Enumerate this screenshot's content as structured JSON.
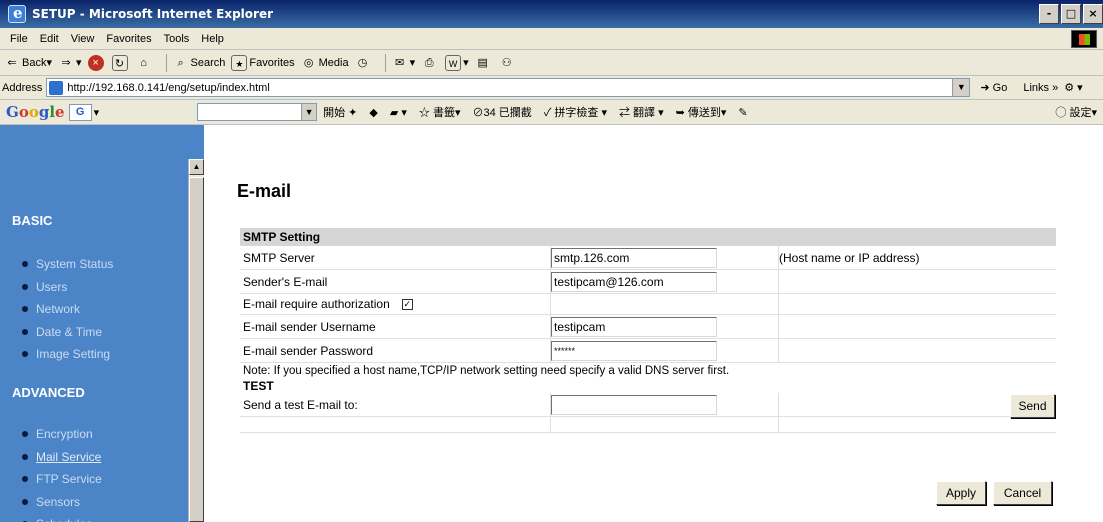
{
  "window": {
    "title": "SETUP - Microsoft Internet Explorer",
    "buttons": [
      "-",
      "□",
      "×"
    ]
  },
  "menu": [
    "File",
    "Edit",
    "View",
    "Favorites",
    "Tools",
    "Help"
  ],
  "toolbar": {
    "back": "Back",
    "search": "Search",
    "favorites": "Favorites",
    "media": "Media"
  },
  "address": {
    "label": "Address",
    "url": "http://192.168.0.141/eng/setup/index.html",
    "go": "Go",
    "links": "Links"
  },
  "google": {
    "logo": [
      "G",
      "o",
      "o",
      "g",
      "l",
      "e"
    ],
    "items": [
      "開始",
      "書籤",
      "34 已攔截",
      "拼字檢查",
      "翻譯",
      "傳送到"
    ],
    "settings": "設定"
  },
  "sidebar": {
    "basic_title": "BASIC",
    "basic_items": [
      "System Status",
      "Users",
      "Network",
      "Date & Time",
      "Image Setting"
    ],
    "advanced_title": "ADVANCED",
    "advanced_items": [
      "Encryption",
      "Mail Service",
      "FTP Service",
      "Sensors",
      "Schedules"
    ],
    "active_item": "Mail Service"
  },
  "page": {
    "title": "E-mail",
    "smtp_section": "SMTP Setting",
    "smtp_server_label": "SMTP Server",
    "smtp_server_value": "smtp.126.com",
    "smtp_server_hint": "(Host name or IP address)",
    "sender_email_label": "Sender's E-mail",
    "sender_email_value": "testipcam@126.com",
    "auth_label": "E-mail require authorization",
    "auth_checked": true,
    "username_label": "E-mail sender Username",
    "username_value": "testipcam",
    "password_label": "E-mail sender Password",
    "password_value": "******",
    "note": "Note: If you specified a host name,TCP/IP network setting need specify a valid DNS server first.",
    "test_section": "TEST",
    "test_label": "Send a test E-mail to:",
    "test_value": "",
    "send_button": "Send",
    "apply_button": "Apply",
    "cancel_button": "Cancel"
  }
}
